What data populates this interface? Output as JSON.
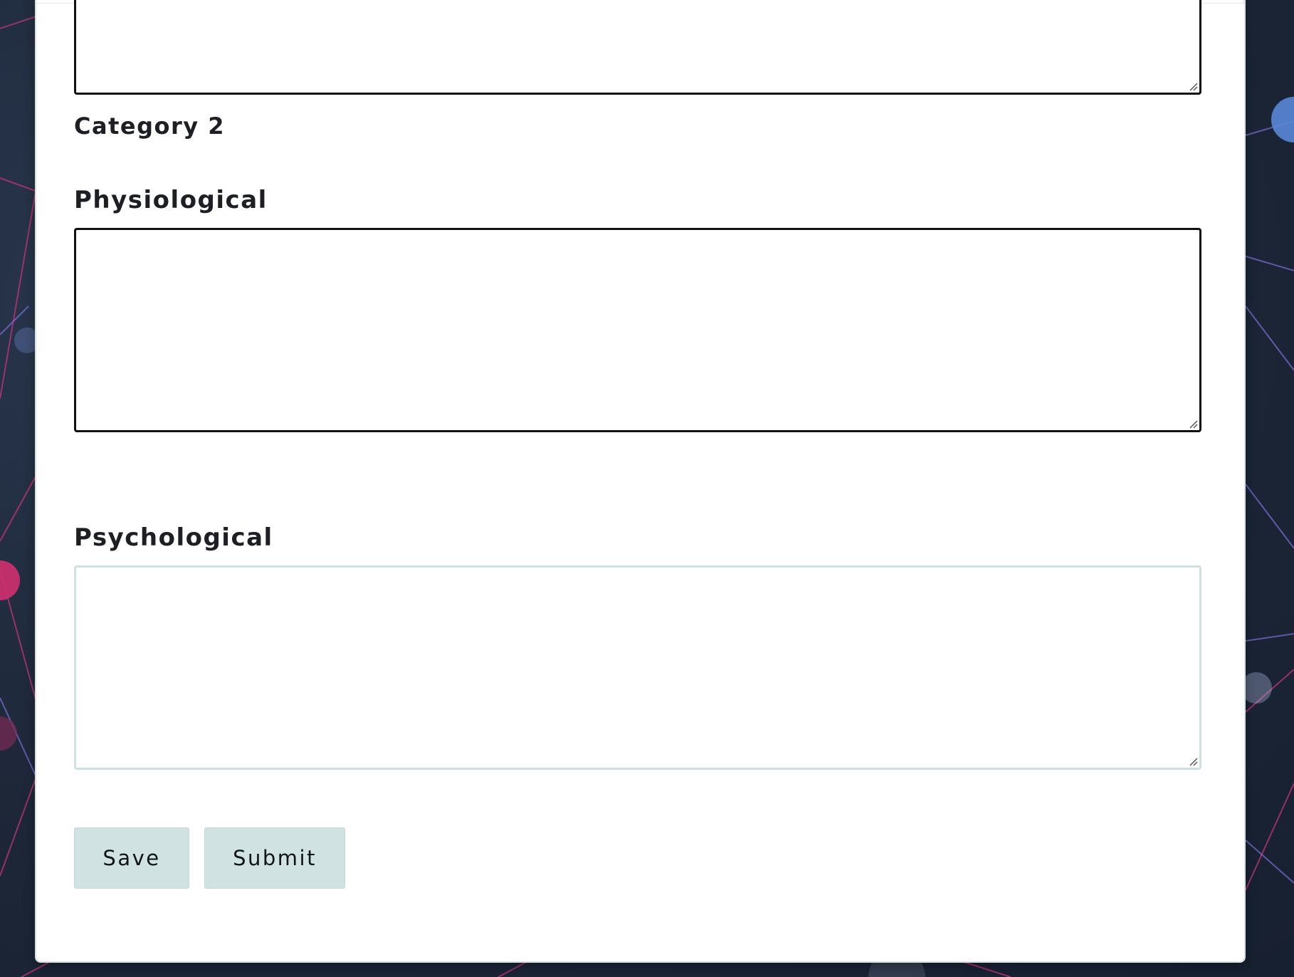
{
  "form": {
    "category_heading": "Category 2",
    "fields": [
      {
        "label": "Physiological",
        "value": "",
        "state": "focused"
      },
      {
        "label": "Psychological",
        "value": "",
        "state": "default"
      }
    ],
    "previous_field_value": ""
  },
  "actions": {
    "save_label": "Save",
    "submit_label": "Submit"
  },
  "colors": {
    "button_bg": "#d1e2e2",
    "focused_border": "#111111",
    "default_border": "#cfe0e0",
    "page_bg": "#1f2a3b",
    "text": "#1d1f24"
  },
  "icons": {
    "resize_grip": "resize-grip-icon"
  }
}
